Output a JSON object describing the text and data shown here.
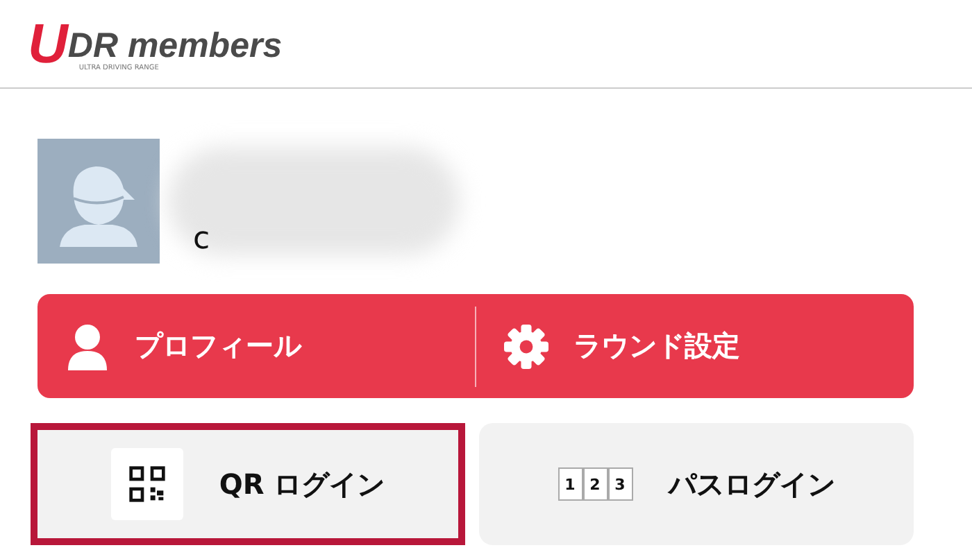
{
  "header": {
    "logo_letter": "U",
    "logo_text": "DR members",
    "logo_tagline": "ULTRA DRIVING RANGE"
  },
  "user": {
    "name_visible": "c"
  },
  "actions": [
    {
      "kind": "profile",
      "label": "プロフィール"
    },
    {
      "kind": "settings",
      "label": "ラウンド設定"
    }
  ],
  "login_options": [
    {
      "kind": "qr",
      "label": "QR ログイン",
      "selected": true
    },
    {
      "kind": "digits",
      "label": "パスログイン",
      "digits": [
        "1",
        "2",
        "3"
      ],
      "selected": false
    }
  ]
}
